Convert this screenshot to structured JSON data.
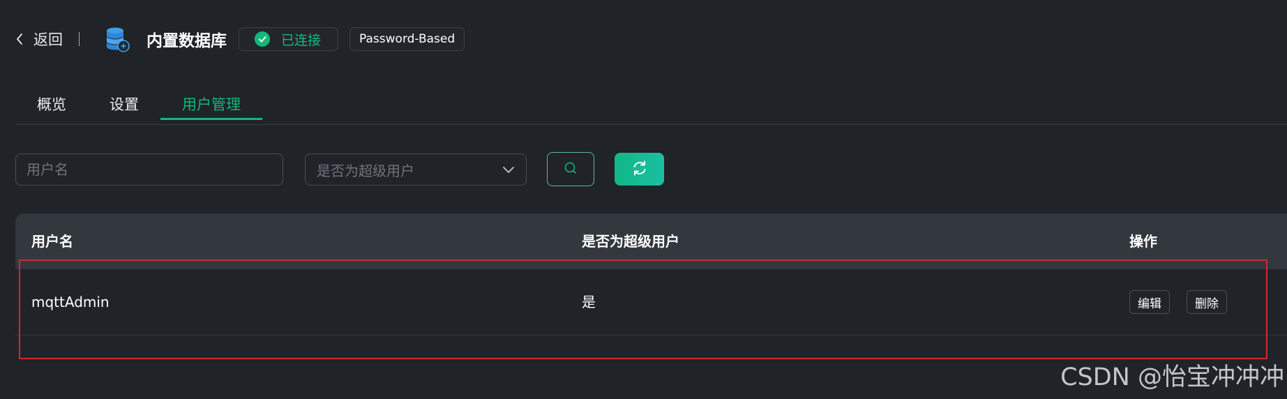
{
  "header": {
    "back_label": "返回",
    "title": "内置数据库",
    "status": "已连接",
    "auth_type": "Password-Based"
  },
  "tabs": [
    {
      "label": "概览",
      "active": false
    },
    {
      "label": "设置",
      "active": false
    },
    {
      "label": "用户管理",
      "active": true
    }
  ],
  "filters": {
    "username_placeholder": "用户名",
    "superuser_placeholder": "是否为超级用户"
  },
  "table": {
    "columns": [
      "用户名",
      "是否为超级用户",
      "操作"
    ],
    "rows": [
      {
        "username": "mqttAdmin",
        "is_superuser": "是",
        "edit_label": "编辑",
        "delete_label": "删除"
      }
    ]
  },
  "watermark": "CSDN @怡宝冲冲冲",
  "colors": {
    "accent": "#12b87a",
    "background": "#202328",
    "header_bg": "#33373e",
    "highlight": "#d12a2a"
  },
  "icons": {
    "back": "chevron-left-icon",
    "database": "database-icon",
    "status": "check-circle-icon",
    "select": "chevron-down-icon",
    "search": "search-icon",
    "refresh": "refresh-icon"
  }
}
